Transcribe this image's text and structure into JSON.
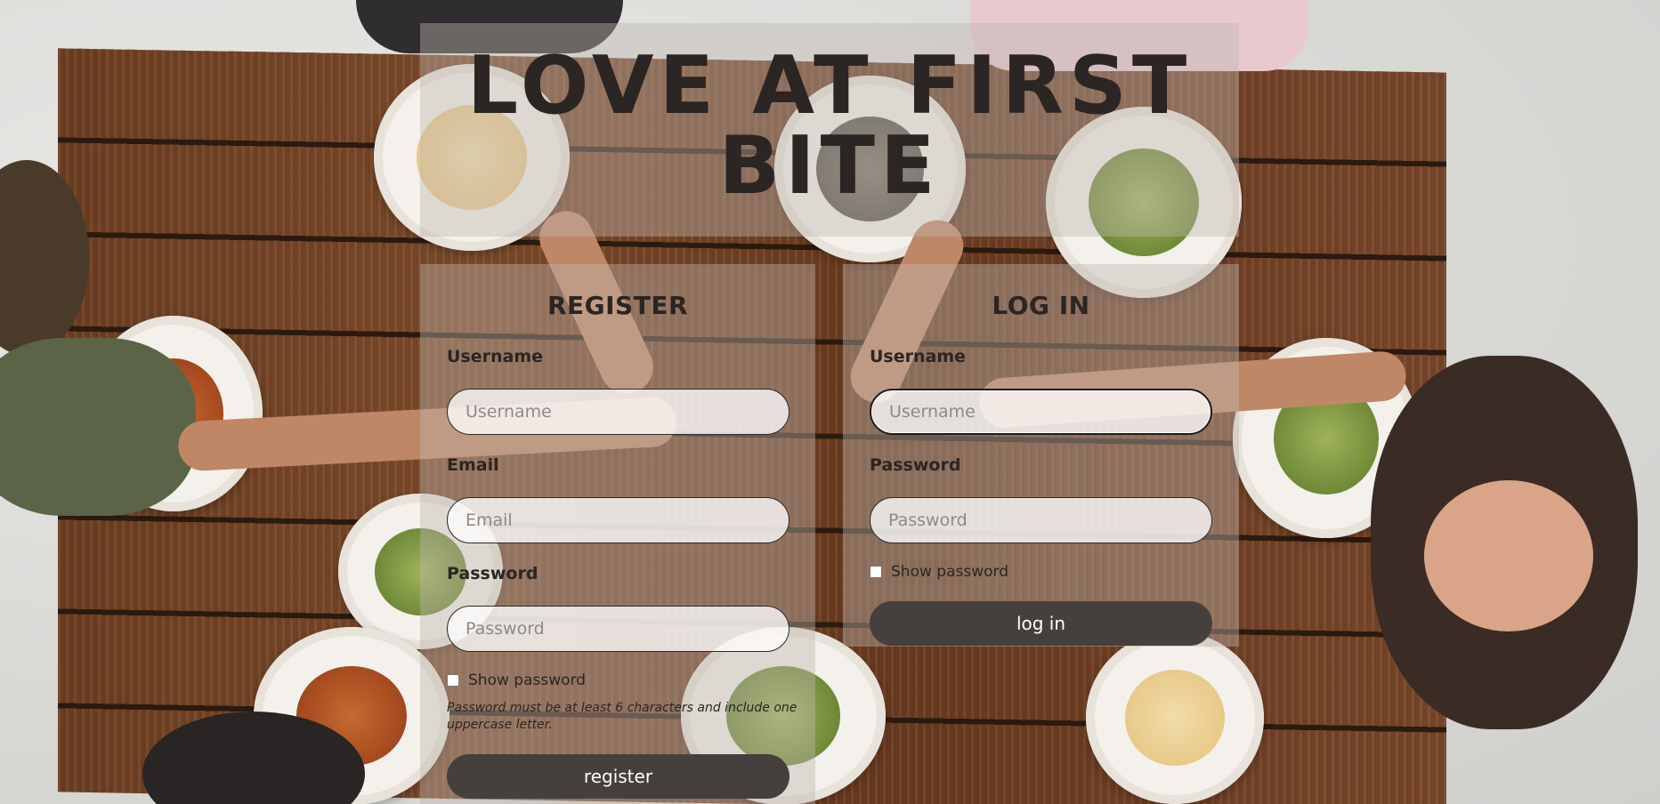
{
  "page": {
    "title": "LOVE AT FIRST BITE"
  },
  "register": {
    "heading": "REGISTER",
    "username_label": "Username",
    "username_placeholder": "Username",
    "email_label": "Email",
    "email_placeholder": "Email",
    "password_label": "Password",
    "password_placeholder": "Password",
    "show_password_label": "Show password",
    "password_hint": "Password must be at least 6 characters and include one uppercase letter.",
    "submit_label": "register"
  },
  "login": {
    "heading": "LOG IN",
    "username_label": "Username",
    "username_placeholder": "Username",
    "password_label": "Password",
    "password_placeholder": "Password",
    "show_password_label": "Show password",
    "submit_label": "log in"
  },
  "colors": {
    "button_bg": "#45403d",
    "text": "#2b2523",
    "panel_overlay": "rgba(190,180,175,0.42)"
  }
}
